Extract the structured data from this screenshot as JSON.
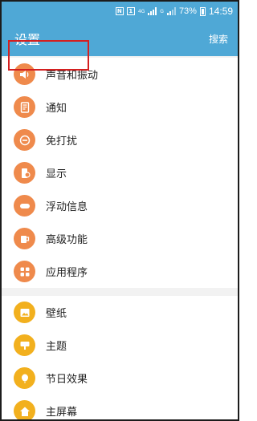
{
  "status_bar": {
    "nfc": "N",
    "sim_badge": "1",
    "network": "4G",
    "signal2_label": "G",
    "battery": "73%",
    "battery_level": 0.73,
    "time": "14:59"
  },
  "app_bar": {
    "title": "设置",
    "search": "搜索"
  },
  "colors": {
    "accent": "#4fa8d6",
    "orange_icon": "#ef8a4c",
    "yellow_icon": "#f2b01e",
    "highlight_box": "#d42020"
  },
  "groups": [
    {
      "items": [
        {
          "label": "声音和振动",
          "icon": "volume-icon",
          "color": "#ef8a4c"
        },
        {
          "label": "通知",
          "icon": "notification-icon",
          "color": "#ef8a4c"
        },
        {
          "label": "免打扰",
          "icon": "do-not-disturb-icon",
          "color": "#ef8a4c"
        },
        {
          "label": "显示",
          "icon": "display-icon",
          "color": "#ef8a4c"
        },
        {
          "label": "浮动信息",
          "icon": "floating-message-icon",
          "color": "#ef8a4c"
        },
        {
          "label": "高级功能",
          "icon": "advanced-features-icon",
          "color": "#ef8a4c"
        },
        {
          "label": "应用程序",
          "icon": "apps-icon",
          "color": "#ef8a4c"
        }
      ]
    },
    {
      "items": [
        {
          "label": "壁纸",
          "icon": "wallpaper-icon",
          "color": "#f2b01e"
        },
        {
          "label": "主题",
          "icon": "theme-icon",
          "color": "#f2b01e"
        },
        {
          "label": "节日效果",
          "icon": "holiday-effect-icon",
          "color": "#f2b01e"
        },
        {
          "label": "主屏幕",
          "icon": "home-screen-icon",
          "color": "#f2b01e"
        }
      ]
    }
  ]
}
